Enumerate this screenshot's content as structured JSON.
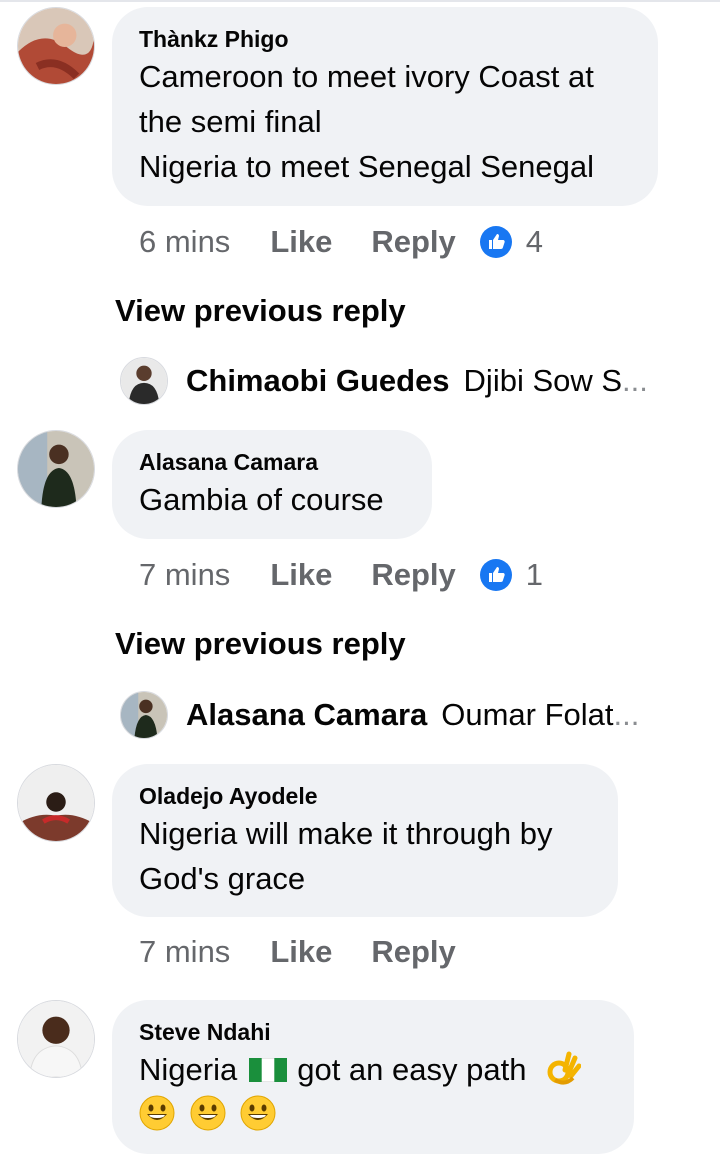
{
  "comments": [
    {
      "author": "Thànkz Phigo",
      "lines": [
        "Cameroon to meet ivory Coast at",
        "the semi final",
        "Nigeria to meet Senegal Senegal"
      ],
      "time": "6 mins",
      "like_label": "Like",
      "reply_label": "Reply",
      "reaction_count": "4"
    },
    {
      "author": "Alasana Camara",
      "lines": [
        "Gambia of course"
      ],
      "time": "7 mins",
      "like_label": "Like",
      "reply_label": "Reply",
      "reaction_count": "1"
    },
    {
      "author": "Oladejo Ayodele",
      "lines": [
        "Nigeria will make it through by",
        "God's grace"
      ],
      "time": "7 mins",
      "like_label": "Like",
      "reply_label": "Reply"
    },
    {
      "author": "Steve Ndahi",
      "text_before_flag": "Nigeria",
      "text_after_flag": "got an easy path",
      "emoji_line": [
        "grinning-face",
        "grinning-face",
        "grinning-face"
      ],
      "trailing_emoji": "ok-hand"
    }
  ],
  "view_previous_reply_label": "View previous reply",
  "replies": [
    {
      "author": "Chimaobi Guedes",
      "snippet": "Djibi Sow S",
      "ellipsis": "..."
    },
    {
      "author": "Alasana Camara",
      "snippet": "Oumar Folat",
      "ellipsis": "..."
    }
  ],
  "colors": {
    "bubble_bg": "#f0f2f5",
    "meta_text": "#65676b",
    "like_icon_blue": "#1877f2"
  }
}
